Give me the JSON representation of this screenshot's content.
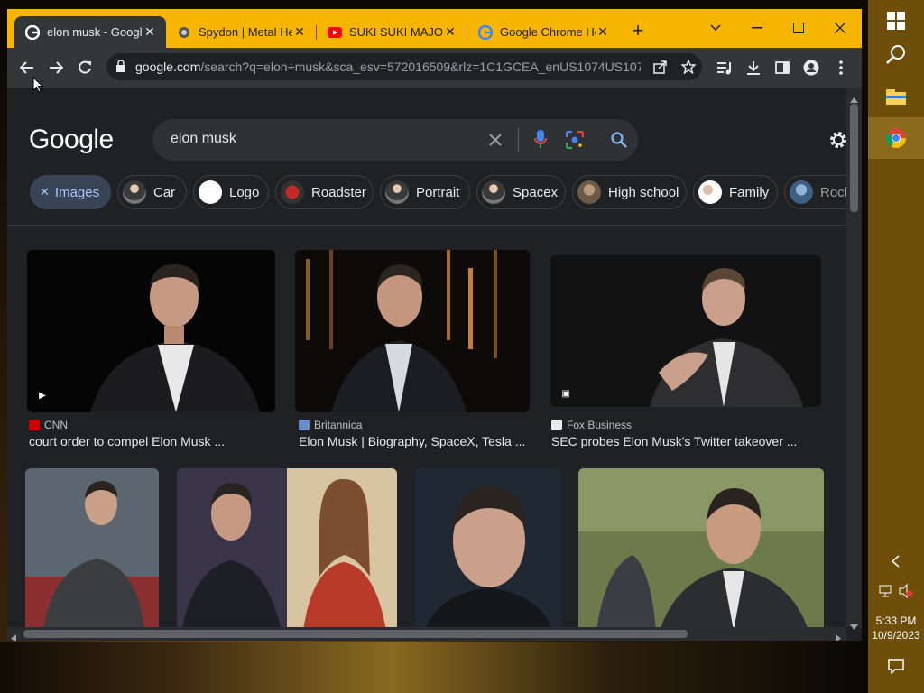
{
  "browser": {
    "tabs": [
      {
        "title": "elon musk - Google",
        "active": true
      },
      {
        "title": "Spydon | Metal He"
      },
      {
        "title": "SUKI SUKI MAJOSE"
      },
      {
        "title": "Google Chrome He"
      }
    ],
    "new_tab": "+",
    "close_glyph": "✕",
    "url_host": "google.com",
    "url_rest": "/search?q=elon+musk&sca_esv=572016509&rlz=1C1GCEA_enUS1074US107..."
  },
  "search": {
    "logo": "Google",
    "query": "elon musk"
  },
  "chips": [
    {
      "label": "Images",
      "selected": true
    },
    {
      "label": "Car"
    },
    {
      "label": "Logo"
    },
    {
      "label": "Roadster"
    },
    {
      "label": "Portrait"
    },
    {
      "label": "Spacex"
    },
    {
      "label": "High school"
    },
    {
      "label": "Family"
    },
    {
      "label": "Rock"
    }
  ],
  "results": [
    {
      "source": "CNN",
      "caption": "court order to compel Elon Musk ..."
    },
    {
      "source": "Britannica",
      "caption": "Elon Musk | Biography, SpaceX, Tesla ..."
    },
    {
      "source": "Fox Business",
      "caption": "SEC probes Elon Musk's Twitter takeover ..."
    }
  ],
  "colors": {
    "tabstrip": "#f7b500",
    "toolbar": "#35363a",
    "page_bg": "#202124",
    "taskbar": "#6d4f0a"
  },
  "clock": {
    "time": "5:33 PM",
    "date": "10/9/2023"
  }
}
